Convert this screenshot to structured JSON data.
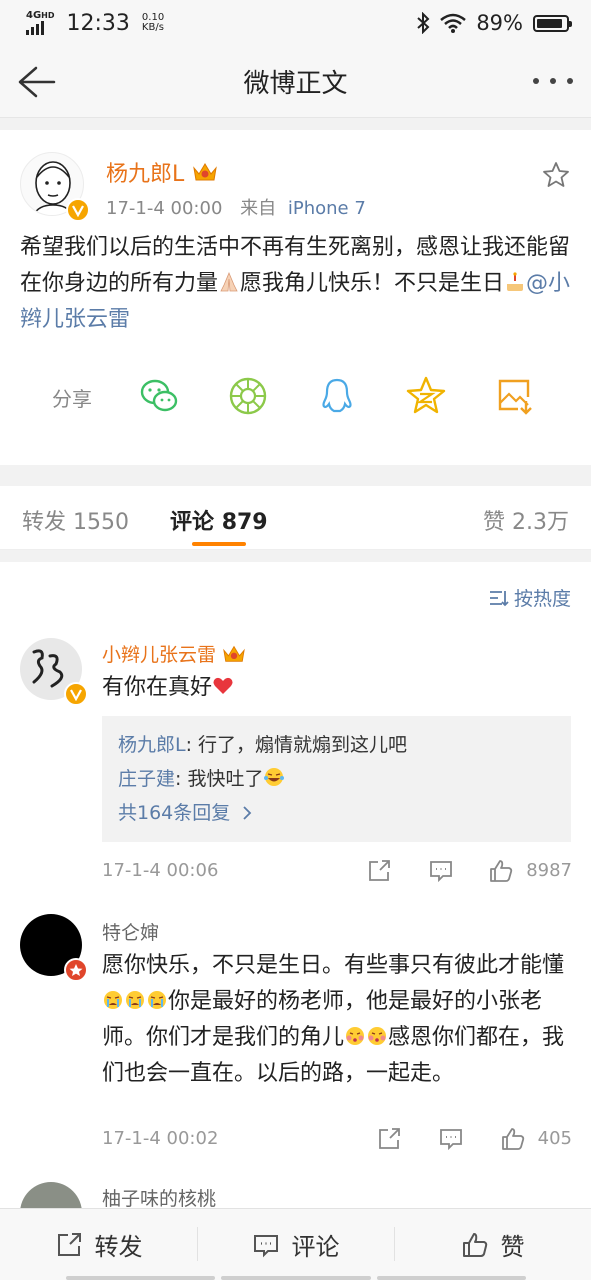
{
  "status_bar": {
    "network": "4G",
    "network_sup": "HD",
    "time": "12:33",
    "speed_value": "0.10",
    "speed_unit": "KB/s",
    "battery": "89%",
    "battery_level": 0.89
  },
  "nav": {
    "title": "微博正文",
    "back_icon": "back-arrow-icon",
    "more_icon": "more-icon"
  },
  "post": {
    "author": "杨九郎L",
    "time": "17-1-4 00:00",
    "source_prefix": "来自",
    "source": "iPhone 7",
    "text_part1": "希望我们以后的生活中不再有生死离别，感恩让我还能留在你身边的所有力量",
    "text_part2": "愿我角儿快乐！不只是生日",
    "mention": "@小辫儿张云雷",
    "share_label": "分享",
    "share_targets": [
      "wechat-icon",
      "moments-icon",
      "qq-icon",
      "qzone-icon",
      "save-image-icon"
    ],
    "accent_orange": "#e8731a",
    "link_blue": "#5b7ca8"
  },
  "tabs": {
    "repost_label": "转发",
    "repost_count": "1550",
    "comment_label": "评论",
    "comment_count": "879",
    "like_label": "赞",
    "like_count": "2.3万"
  },
  "sort": {
    "label": "按热度"
  },
  "comments": [
    {
      "name": "小辫儿张云雷",
      "text": "有你在真好",
      "replies": [
        {
          "name": "杨九郎L",
          "text": ": 行了，煽情就煽到这儿吧"
        },
        {
          "name": "庄子建",
          "text": ": 我快吐了"
        }
      ],
      "more_replies": "共164条回复",
      "time": "17-1-4 00:06",
      "likes": "8987"
    },
    {
      "name": "特仑婶",
      "text_a": "愿你快乐，不只是生日。有些事只有彼此才能懂",
      "text_b": "你是最好的杨老师，他是最好的小张老师。你们才是我们的角儿",
      "text_c": "感恩你们都在，我们也会一直在。以后的路，一起走。",
      "time": "17-1-4 00:02",
      "likes": "405"
    },
    {
      "name": "柚子味的核桃"
    }
  ],
  "toolbar": {
    "repost": "转发",
    "comment": "评论",
    "like": "赞"
  }
}
